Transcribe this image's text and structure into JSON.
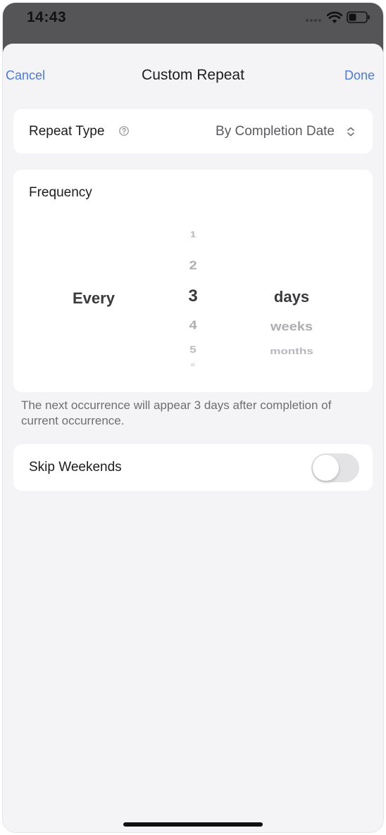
{
  "status_bar": {
    "time": "14:43"
  },
  "nav": {
    "cancel_label": "Cancel",
    "title": "Custom Repeat",
    "done_label": "Done"
  },
  "repeat_type": {
    "label": "Repeat Type",
    "value": "By Completion Date",
    "help_icon": "question-circle-icon",
    "selector_icon": "chevron-up-down-icon"
  },
  "frequency": {
    "label": "Frequency",
    "prefix": "Every",
    "numbers": [
      "1",
      "2",
      "3",
      "4",
      "5",
      "6"
    ],
    "selected_number": "3",
    "units": [
      "days",
      "weeks",
      "months"
    ],
    "selected_unit": "days"
  },
  "footnote": "The next occurrence will appear 3 days after completion of current occurrence.",
  "skip_weekends": {
    "label": "Skip Weekends",
    "enabled": false
  },
  "colors": {
    "accent": "#4a7ae0",
    "background": "#f4f4f6",
    "status_bar": "#555558"
  }
}
